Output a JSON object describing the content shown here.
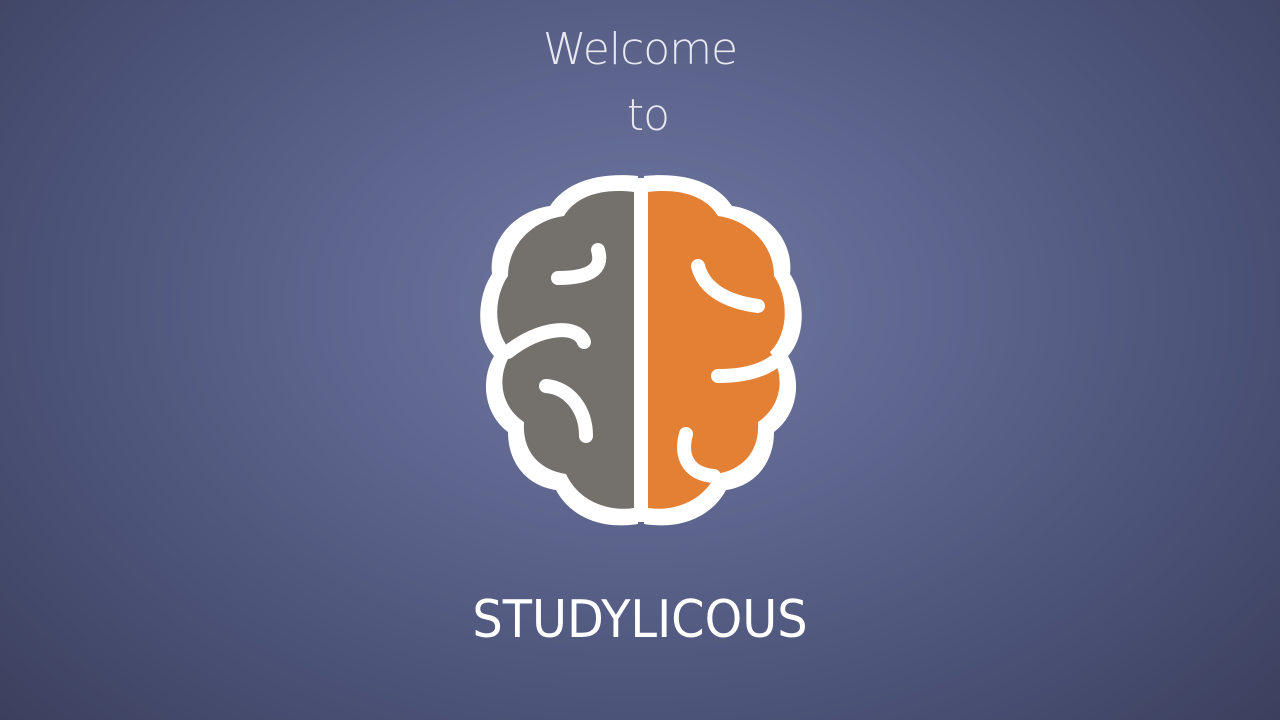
{
  "splash": {
    "welcome_text": "Welcome",
    "to_text": "to",
    "app_name": "STUDYLICOUS",
    "logo_icon": "brain-icon"
  },
  "colors": {
    "background": "#5f6790",
    "left_hemisphere": "#74706b",
    "right_hemisphere": "#e48034",
    "outline": "#ffffff",
    "text": "#ffffff"
  }
}
